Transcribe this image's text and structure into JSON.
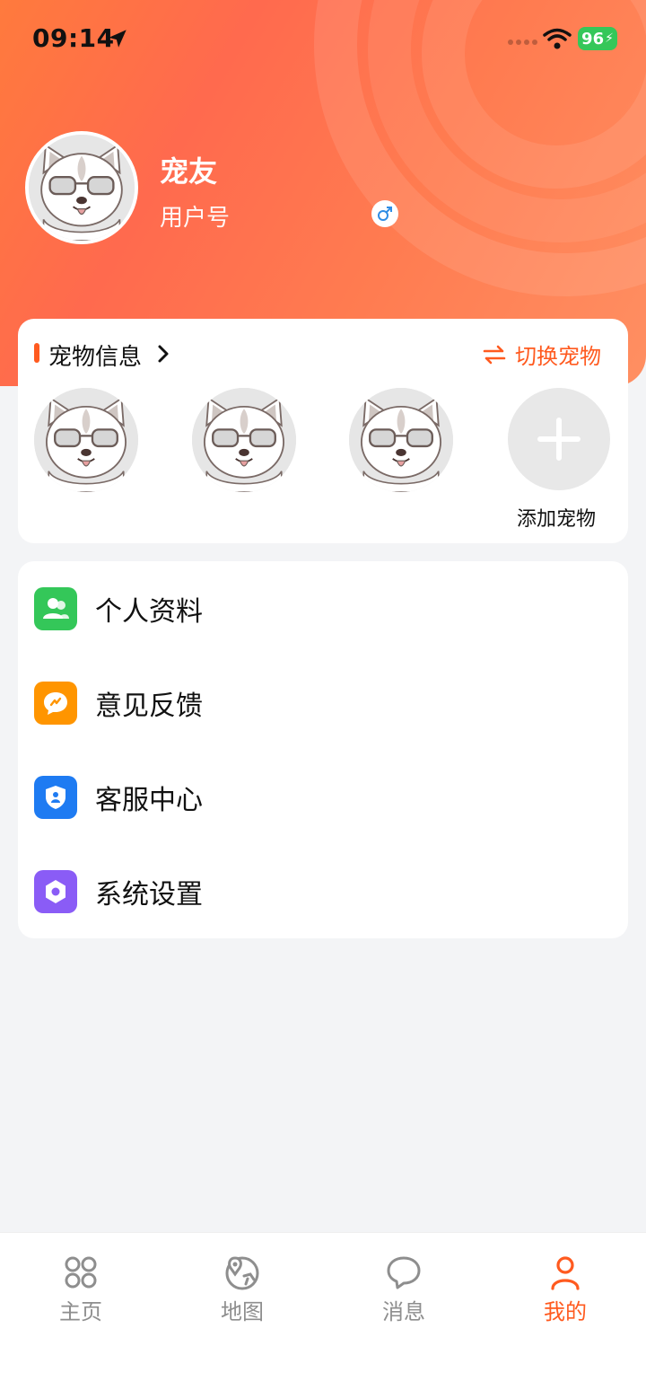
{
  "status_bar": {
    "time": "09:14",
    "battery": "96"
  },
  "profile": {
    "name": "宠友",
    "user_id_label": "用户号"
  },
  "pets": {
    "title": "宠物信息",
    "switch_label": "切换宠物",
    "add_label": "添加宠物",
    "count": 3
  },
  "menu": [
    {
      "label": "个人资料",
      "icon": "people-icon",
      "color": "#34c759"
    },
    {
      "label": "意见反馈",
      "icon": "chat-bubble-icon",
      "color": "#ff9500"
    },
    {
      "label": "客服中心",
      "icon": "shield-user-icon",
      "color": "#1e7bf2"
    },
    {
      "label": "系统设置",
      "icon": "hexagon-settings-icon",
      "color": "#8a5cf6"
    }
  ],
  "tabbar": [
    {
      "label": "主页",
      "icon": "grid-icon",
      "active": false
    },
    {
      "label": "地图",
      "icon": "map-icon",
      "active": false
    },
    {
      "label": "消息",
      "icon": "message-icon",
      "active": false
    },
    {
      "label": "我的",
      "icon": "person-icon",
      "active": true
    }
  ],
  "colors": {
    "accent": "#ff5a1f",
    "hero_start": "#ff7a3d",
    "hero_end": "#ff8f62"
  }
}
